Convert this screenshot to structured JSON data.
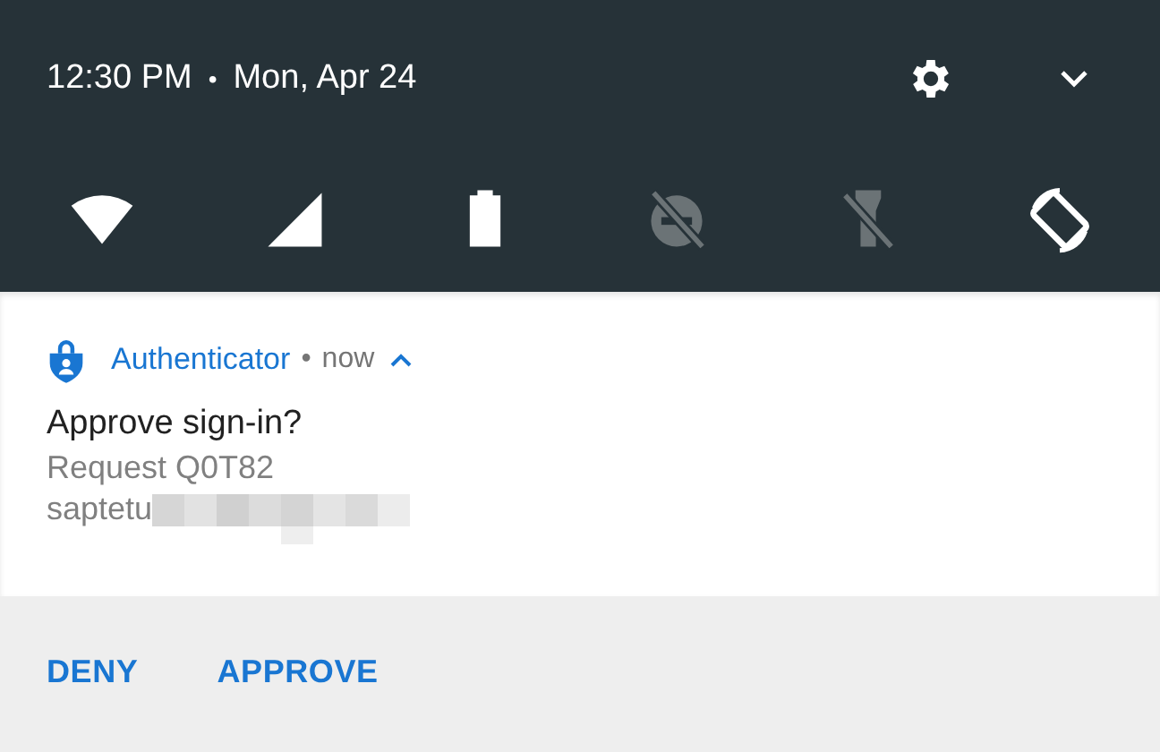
{
  "status_header": {
    "time": "12:30 PM",
    "separator": "•",
    "date": "Mon, Apr 24"
  },
  "quick_tiles": [
    {
      "kind": "wifi",
      "on": true
    },
    {
      "kind": "cellular",
      "on": true
    },
    {
      "kind": "battery",
      "on": true
    },
    {
      "kind": "dnd",
      "on": false
    },
    {
      "kind": "flashlight",
      "on": false
    },
    {
      "kind": "rotate",
      "on": true
    }
  ],
  "notification": {
    "app": "Authenticator",
    "separator": "•",
    "time": "now",
    "expanded": true,
    "title": "Approve sign-in?",
    "lines": [
      "Request Q0T82",
      "saptetu"
    ],
    "redacted": true
  },
  "actions": [
    "DENY",
    "APPROVE"
  ]
}
